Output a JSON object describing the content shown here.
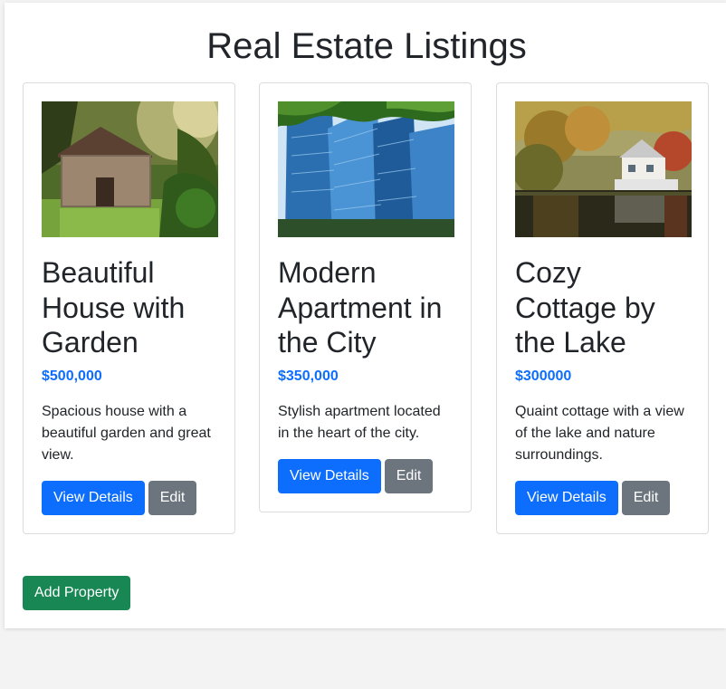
{
  "page": {
    "title": "Real Estate Listings",
    "add_label": "Add Property"
  },
  "colors": {
    "price": "#0d6efd",
    "primary": "#0d6efd",
    "secondary": "#6c757d",
    "success": "#198754"
  },
  "listings": [
    {
      "title": "Beautiful House with Garden",
      "price": "$500,000",
      "description": "Spacious house with a beautiful garden and great view.",
      "view_label": "View Details",
      "edit_label": "Edit",
      "image": "stone-cottage-in-garden"
    },
    {
      "title": "Modern Apartment in the City",
      "price": "$350,000",
      "description": "Stylish apartment located in the heart of the city.",
      "view_label": "View Details",
      "edit_label": "Edit",
      "image": "glass-skyscrapers"
    },
    {
      "title": "Cozy Cottage by the Lake",
      "price": "$300000",
      "description": "Quaint cottage with a view of the lake and nature surroundings.",
      "view_label": "View Details",
      "edit_label": "Edit",
      "image": "lakeside-house-autumn"
    }
  ]
}
